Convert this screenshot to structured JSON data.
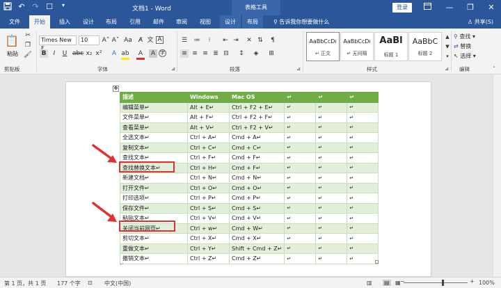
{
  "titlebar": {
    "doc_title": "文档1 - Word",
    "context_label": "表格工具",
    "login_label": "登录",
    "ribbon_display_icon": "ribbon-display-icon",
    "minimize_glyph": "—",
    "restore_glyph": "❐",
    "close_glyph": "✕"
  },
  "tabs": {
    "file": "文件",
    "home": "开始",
    "insert": "插入",
    "design": "设计",
    "layout": "布局",
    "references": "引用",
    "mailings": "邮件",
    "review": "审阅",
    "view": "视图",
    "table_design": "设计",
    "table_layout": "布局",
    "tell_me": "告诉我你想要做什么",
    "share": "共享(S)"
  },
  "ribbon": {
    "paste_label": "粘贴",
    "clipboard_label": "剪贴板",
    "font_name": "Times New F",
    "font_size": "10",
    "font_label": "字体",
    "paragraph_label": "段落",
    "styles_label": "样式",
    "editing_label": "编辑",
    "styles": [
      {
        "sample": "AaBbCcDı",
        "name": "↵ 正文"
      },
      {
        "sample": "AaBbCcDı",
        "name": "↵ 无间隔"
      },
      {
        "sample": "AaBl",
        "name": "标题 1"
      },
      {
        "sample": "AaBbC",
        "name": "标题 2"
      }
    ],
    "find": "查找",
    "replace": "替换",
    "select": "选择"
  },
  "table": {
    "headers": [
      "描述",
      "Windows",
      "Mac OS",
      "↵",
      "↵",
      "↵"
    ],
    "rows": [
      [
        "编辑菜单↵",
        "Alt + E↵",
        "Ctrl + F2 + E↵"
      ],
      [
        "文件菜单↵",
        "Alt + F↵",
        "Ctrl + F2 + F↵"
      ],
      [
        "查看菜单↵",
        "Alt + V↵",
        "Ctrl + F2 + V↵"
      ],
      [
        "全选文本↵",
        "Ctrl + A↵",
        "Cmd + A↵"
      ],
      [
        "复制文本↵",
        "Ctrl + C↵",
        "Cmd + C↵"
      ],
      [
        "查找文本↵",
        "Ctrl + F↵",
        "Cmd + F↵"
      ],
      [
        "查找替换文本↵",
        "Ctrl + H↵",
        "Cmd + F↵"
      ],
      [
        "新建文档↵",
        "Ctrl + N↵",
        "Cmd + N↵"
      ],
      [
        "打开文件↵",
        "Ctrl + O↵",
        "Cmd + O↵"
      ],
      [
        "打印选项↵",
        "Ctrl + P↵",
        "Cmd + P↵"
      ],
      [
        "保存文件↵",
        "Ctrl + S↵",
        "Cmd + S↵"
      ],
      [
        "粘贴文本↵",
        "Ctrl + V↵",
        "Cmd + V↵"
      ],
      [
        "关闭当前网页↵",
        "Ctrl + w↵",
        "Cmd + W↵"
      ],
      [
        "剪切文本↵",
        "Ctrl + X↵",
        "Cmd + X↵"
      ],
      [
        "重做文本↵",
        "Ctrl + Y↵",
        "Shift + Cmd + Z↵"
      ],
      [
        "撤销文本↵",
        "Ctrl + Z↵",
        "Cmd + Z↵"
      ]
    ],
    "empty_cell": "↵",
    "after_paragraph": "↵"
  },
  "statusbar": {
    "page": "第 1 页，共 1 页",
    "words": "177 个字",
    "language": "中文(中国)",
    "zoom": "100%"
  },
  "colors": {
    "accent": "#2b579a",
    "table_header": "#70ad47",
    "table_band": "#e2efda",
    "highlight": "#e03030"
  }
}
